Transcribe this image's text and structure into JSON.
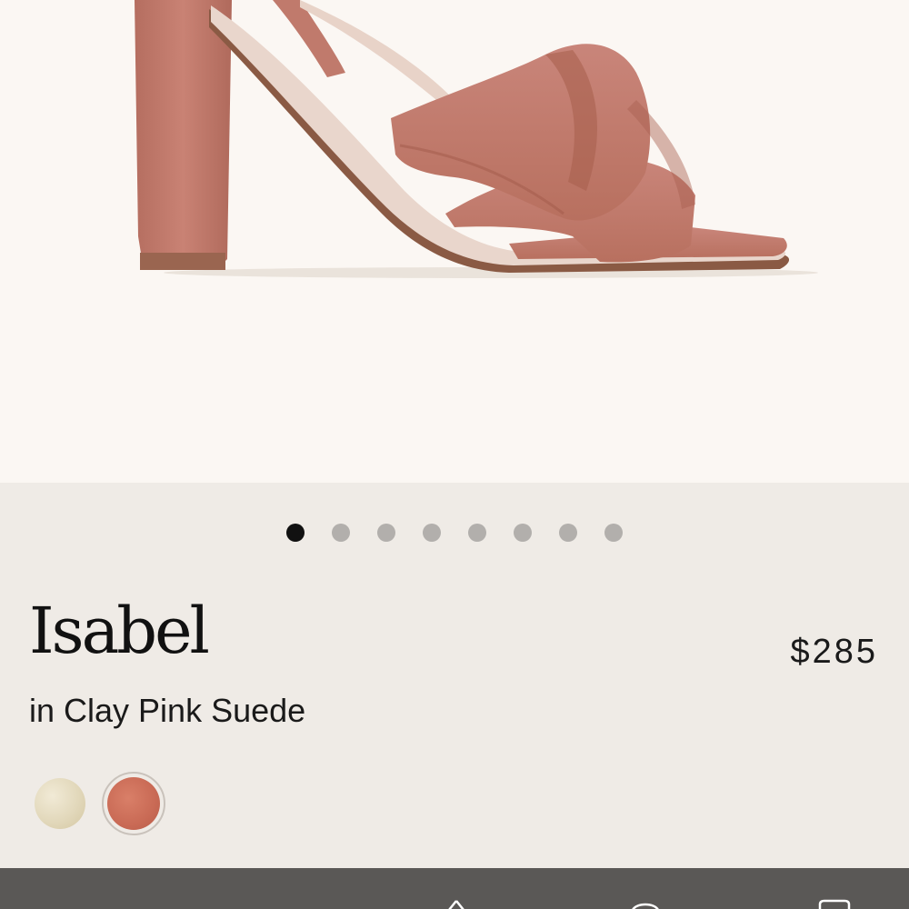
{
  "product": {
    "name": "Isabel",
    "variant": "in Clay Pink Suede",
    "price": "$285"
  },
  "carousel": {
    "total": 8,
    "active_index": 0
  },
  "swatches": [
    {
      "name": "gold",
      "color": "#e2d8bb",
      "selected": false
    },
    {
      "name": "clay-pink",
      "color": "#c96a55",
      "selected": true
    }
  ],
  "colors": {
    "hero_bg": "#fbf7f3",
    "panel_bg": "#efebe6",
    "suede": "#c07a6c",
    "bottom_bar": "#5a5856"
  }
}
